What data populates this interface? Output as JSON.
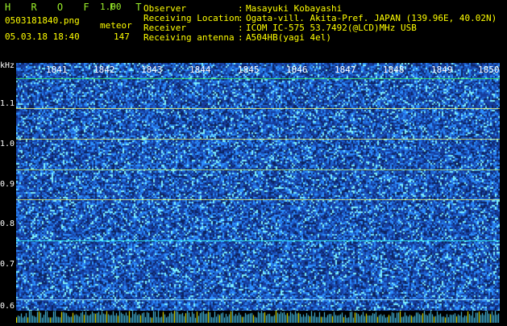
{
  "header": {
    "app_name": "H R O F F T",
    "version": "1.00",
    "file_name": "0503181840.png",
    "datetime": "05.03.18 18:40",
    "meteor_label": "meteor",
    "meteor_count": "147",
    "observer_label": "Observer",
    "observer_value": "Masayuki Kobayashi",
    "location_label": "Receiving Location",
    "location_value": "Ogata-vill. Akita-Pref. JAPAN (139.96E, 40.02N)",
    "receiver_label": "Receiver",
    "receiver_value": "ICOM IC-575 53.7492(@LCD)MHz USB",
    "antenna_label": "Receiving antenna",
    "antenna_value": "A504HB(yagi 4el)",
    "colon": ":"
  },
  "axes": {
    "y_unit": "kHz",
    "y_ticks": [
      "1.1",
      "1.0",
      "0.9",
      "0.8",
      "0.7",
      "0.6"
    ],
    "x_ticks": [
      "1841",
      "1842",
      "1843",
      "1844",
      "1845",
      "1846",
      "1847",
      "1848",
      "1849",
      "1850"
    ]
  },
  "colors": {
    "primary": "#ffff00",
    "accent": "#9bef2a",
    "background": "#000000"
  }
}
